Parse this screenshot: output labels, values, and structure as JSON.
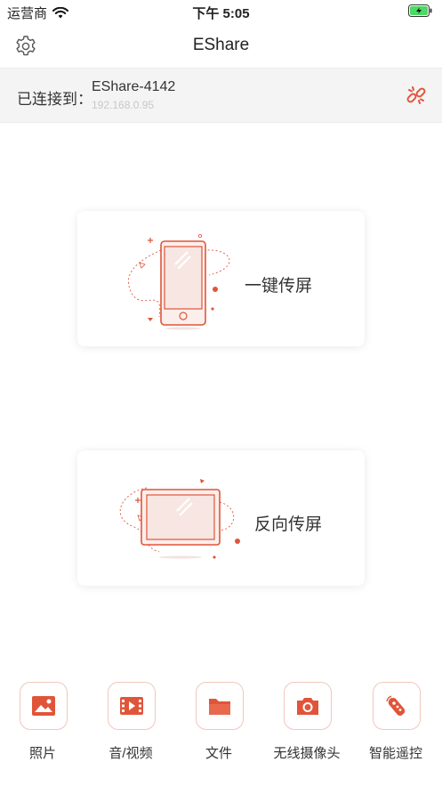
{
  "status_bar": {
    "carrier": "运营商",
    "time": "下午 5:05"
  },
  "nav": {
    "title": "EShare",
    "settings_icon": "gear-icon"
  },
  "connection": {
    "label": "已连接到：",
    "device_name": "EShare-4142",
    "ip": "192.168.0.95",
    "disconnect_icon": "broken-link-icon"
  },
  "cards": {
    "mirror": {
      "label": "一键传屏",
      "icon": "phone-illustration"
    },
    "reverse": {
      "label": "反向传屏",
      "icon": "tablet-illustration"
    }
  },
  "tools": [
    {
      "label": "照片",
      "icon": "photo-icon"
    },
    {
      "label": "音/视频",
      "icon": "video-icon"
    },
    {
      "label": "文件",
      "icon": "folder-icon"
    },
    {
      "label": "无线摄像头",
      "icon": "camera-icon"
    },
    {
      "label": "智能遥控",
      "icon": "remote-icon"
    }
  ],
  "colors": {
    "accent": "#e0553a",
    "accent_light": "#f7e6e2",
    "bar_bg": "#f4f4f4"
  }
}
